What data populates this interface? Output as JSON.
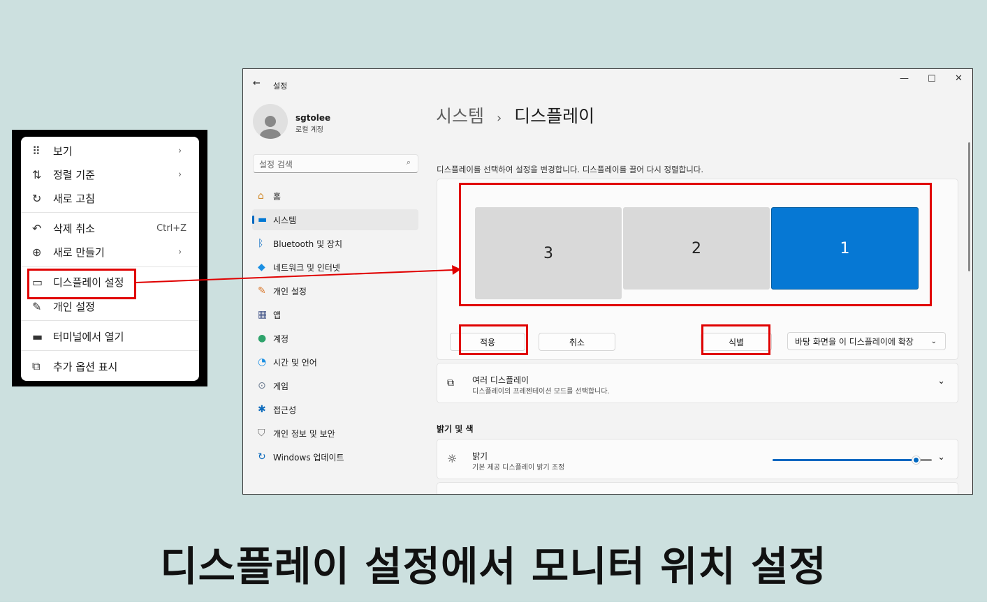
{
  "context_menu": {
    "items": [
      {
        "icon": "view-icon",
        "glyph": "⠿",
        "label": "보기",
        "submenu": true,
        "shortcut": ""
      },
      {
        "icon": "sort-icon",
        "glyph": "⇅",
        "label": "정렬 기준",
        "submenu": true,
        "shortcut": ""
      },
      {
        "icon": "refresh-icon",
        "glyph": "↻",
        "label": "새로 고침",
        "submenu": false,
        "shortcut": ""
      },
      {
        "icon": "undo-icon",
        "glyph": "↶",
        "label": "삭제 취소",
        "submenu": false,
        "shortcut": "Ctrl+Z"
      },
      {
        "icon": "new-icon",
        "glyph": "⊕",
        "label": "새로 만들기",
        "submenu": true,
        "shortcut": ""
      },
      {
        "icon": "display-settings-icon",
        "glyph": "▭",
        "label": "디스플레이 설정",
        "submenu": false,
        "shortcut": ""
      },
      {
        "icon": "personalize-icon",
        "glyph": "✎",
        "label": "개인 설정",
        "submenu": false,
        "shortcut": ""
      },
      {
        "icon": "terminal-icon",
        "glyph": "▬",
        "label": "터미널에서 열기",
        "submenu": false,
        "shortcut": ""
      },
      {
        "icon": "more-options-icon",
        "glyph": "⧉",
        "label": "추가 옵션 표시",
        "submenu": false,
        "shortcut": ""
      }
    ]
  },
  "window": {
    "title": "설정",
    "controls": {
      "minimize": "—",
      "maximize": "☐",
      "close": "✕"
    }
  },
  "user": {
    "name": "sgtolee",
    "account_type": "로컬 계정"
  },
  "search": {
    "placeholder": "설정 검색"
  },
  "nav": [
    {
      "label": "홈",
      "icon": "home-icon",
      "glyph": "⌂",
      "color": "#d08a2c"
    },
    {
      "label": "시스템",
      "icon": "system-icon",
      "glyph": "▬",
      "color": "#0078d4"
    },
    {
      "label": "Bluetooth 및 장치",
      "icon": "bluetooth-icon",
      "glyph": "ᛒ",
      "color": "#0067c0"
    },
    {
      "label": "네트워크 및 인터넷",
      "icon": "network-icon",
      "glyph": "◆",
      "color": "#1a8fe3"
    },
    {
      "label": "개인 설정",
      "icon": "brush-icon",
      "glyph": "✎",
      "color": "#d9772b"
    },
    {
      "label": "앱",
      "icon": "apps-icon",
      "glyph": "▦",
      "color": "#4a5b8c"
    },
    {
      "label": "계정",
      "icon": "account-icon",
      "glyph": "●",
      "color": "#2ea36b"
    },
    {
      "label": "시간 및 언어",
      "icon": "time-language-icon",
      "glyph": "◔",
      "color": "#1a8fe3"
    },
    {
      "label": "게임",
      "icon": "gaming-icon",
      "glyph": "⊙",
      "color": "#6b7a8f"
    },
    {
      "label": "접근성",
      "icon": "accessibility-icon",
      "glyph": "✱",
      "color": "#0f6cbd"
    },
    {
      "label": "개인 정보 및 보안",
      "icon": "shield-icon",
      "glyph": "⛉",
      "color": "#6b6b6b"
    },
    {
      "label": "Windows 업데이트",
      "icon": "update-icon",
      "glyph": "↻",
      "color": "#0f6cbd"
    }
  ],
  "breadcrumb": {
    "parent": "시스템",
    "separator": "›",
    "current": "디스플레이"
  },
  "display": {
    "instruction": "디스플레이를 선택하여 설정을 변경합니다. 디스플레이를 끌어 다시 정렬합니다.",
    "monitors": [
      {
        "label": "3",
        "selected": false
      },
      {
        "label": "2",
        "selected": false
      },
      {
        "label": "1",
        "selected": true
      }
    ],
    "apply_label": "적용",
    "cancel_label": "취소",
    "identify_label": "식별",
    "mode_select": "바탕 화면을 이 디스플레이에 확장"
  },
  "multi_display": {
    "title": "여러 디스플레이",
    "subtitle": "디스플레이의 프레젠테이션 모드를 선택합니다."
  },
  "brightness_section": {
    "heading": "밝기 및 색"
  },
  "brightness": {
    "title": "밝기",
    "subtitle": "기본 제공 디스플레이 밝기 조정",
    "level": 0.9
  },
  "caption": "디스플레이 설정에서 모니터 위치 설정",
  "colors": {
    "accent": "#0078d4",
    "highlight": "#e00000"
  }
}
